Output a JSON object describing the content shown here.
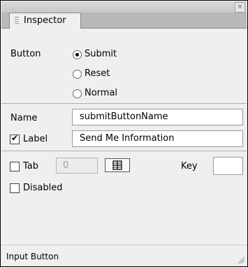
{
  "close_icon": "close-icon",
  "tab": {
    "label": "Inspector"
  },
  "button_section": {
    "label": "Button",
    "options": [
      {
        "label": "Submit",
        "selected": true
      },
      {
        "label": "Reset",
        "selected": false
      },
      {
        "label": "Normal",
        "selected": false
      }
    ]
  },
  "name_field": {
    "label": "Name",
    "value": "submitButtonName"
  },
  "label_field": {
    "label": "Label",
    "checked": true,
    "value": "Send Me Information"
  },
  "tab_field": {
    "label": "Tab",
    "checked": false,
    "value": "0"
  },
  "key_field": {
    "label": "Key",
    "value": ""
  },
  "disabled_field": {
    "label": "Disabled",
    "checked": false
  },
  "status": {
    "text": "Input Button"
  }
}
